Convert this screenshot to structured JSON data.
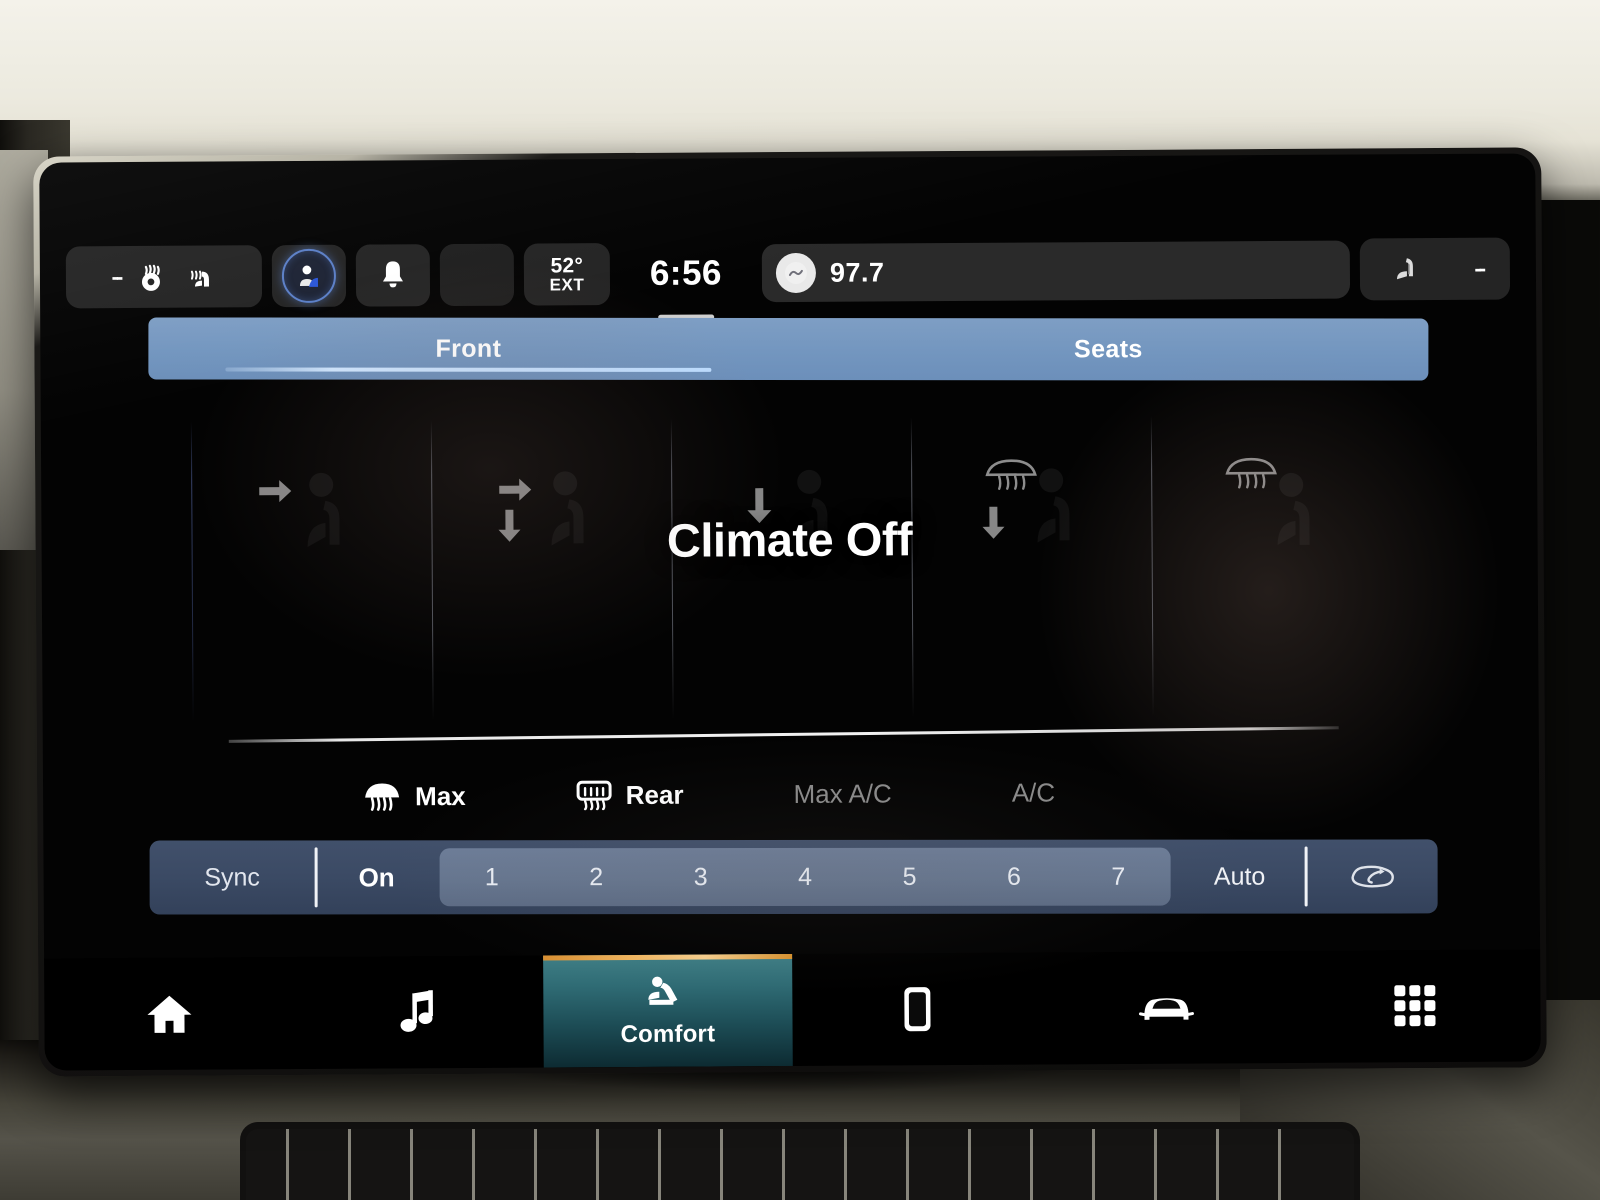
{
  "device": {
    "kind": "automotive-infotainment-touchscreen"
  },
  "status_bar": {
    "left_group": {
      "dash_glyph": "--",
      "icons": [
        "heated-steering-wheel-icon",
        "heated-seat-icon"
      ]
    },
    "profile_icon": "driver-profile-icon",
    "notification_icon": "bell-icon",
    "blank_tile": "",
    "exterior_temp": {
      "value": "52°",
      "label": "EXT"
    },
    "clock": "6:56",
    "media": {
      "source_icon": "radio-disc-icon",
      "station": "97.7"
    },
    "right_group": {
      "icon": "seat-icon",
      "dash_glyph": "--"
    }
  },
  "tabs": [
    {
      "label": "Front",
      "active": true
    },
    {
      "label": "Seats",
      "active": false
    }
  ],
  "climate": {
    "status_text": "Climate Off",
    "zones": [
      {
        "name": "driver-airflow-face",
        "icons": [
          "arrow-right",
          "seat"
        ]
      },
      {
        "name": "driver-airflow-face-feet",
        "icons": [
          "arrow-right",
          "arrow-down",
          "seat"
        ]
      },
      {
        "name": "center-airflow-feet",
        "icons": [
          "arrow-down",
          "seat"
        ]
      },
      {
        "name": "passenger-defrost-feet",
        "icons": [
          "defrost",
          "arrow-down",
          "seat"
        ]
      },
      {
        "name": "passenger-defrost",
        "icons": [
          "defrost",
          "seat"
        ]
      }
    ],
    "functions": [
      {
        "label": "Max",
        "icon": "defrost-icon",
        "active": true
      },
      {
        "label": "Rear",
        "icon": "rear-defrost-icon",
        "active": true
      },
      {
        "label": "Max A/C",
        "icon": null,
        "active": false
      },
      {
        "label": "A/C",
        "icon": null,
        "active": false
      }
    ],
    "fan_bar": {
      "sync_label": "Sync",
      "power_label": "On",
      "speeds": [
        "1",
        "2",
        "3",
        "4",
        "5",
        "6",
        "7"
      ],
      "auto_label": "Auto",
      "recirculation_icon": "recirculation-icon"
    }
  },
  "nav": [
    {
      "label": "",
      "icon": "home-icon",
      "active": false
    },
    {
      "label": "",
      "icon": "music-note-icon",
      "active": false
    },
    {
      "label": "Comfort",
      "icon": "comfort-seat-icon",
      "active": true
    },
    {
      "label": "",
      "icon": "phone-icon",
      "active": false
    },
    {
      "label": "",
      "icon": "car-icon",
      "active": false
    },
    {
      "label": "",
      "icon": "apps-grid-icon",
      "active": false
    }
  ],
  "colors": {
    "screen_bg": "#030303",
    "tab_blue": "#7396bf",
    "fanbar_blue": "#3b4a64",
    "fan_track": "#66768f",
    "active_tab_teal": "#2f6b74",
    "active_tab_accent": "#f0b45e",
    "dim_text": "#8b8b8b"
  }
}
